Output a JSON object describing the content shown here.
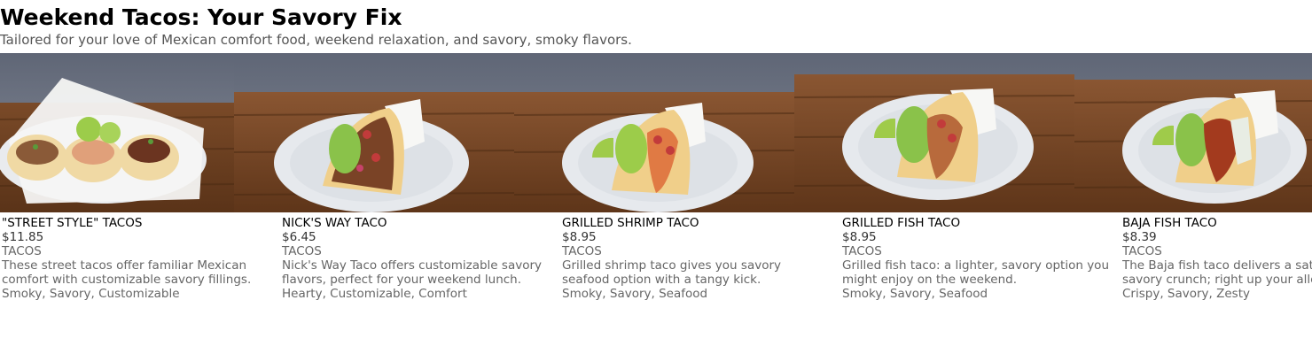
{
  "page": {
    "title": "Weekend Tacos: Your Savory Fix",
    "subtitle": "Tailored for your love of Mexican comfort food, weekend relaxation, and savory, smoky flavors."
  },
  "items": [
    {
      "name": "\"STREET STYLE\" TACOS",
      "price": "$11.85",
      "category": "TACOS",
      "description": "These street tacos offer familiar Mexican comfort with customizable savory fillings.",
      "tags": "Smoky, Savory, Customizable"
    },
    {
      "name": "NICK'S WAY TACO",
      "price": "$6.45",
      "category": "TACOS",
      "description": "Nick's Way Taco offers customizable savory flavors, perfect for your weekend lunch.",
      "tags": "Hearty, Customizable, Comfort"
    },
    {
      "name": "GRILLED SHRIMP TACO",
      "price": "$8.95",
      "category": "TACOS",
      "description": "Grilled shrimp taco gives you savory seafood option with a tangy kick.",
      "tags": "Smoky, Savory, Seafood"
    },
    {
      "name": "GRILLED FISH TACO",
      "price": "$8.95",
      "category": "TACOS",
      "description": "Grilled fish taco: a lighter, savory option you might enjoy on the weekend.",
      "tags": "Smoky, Savory, Seafood"
    },
    {
      "name": "BAJA FISH TACO",
      "price": "$8.39",
      "category": "TACOS",
      "description": "The Baja fish taco delivers a satisfying savory crunch; right up your alley.",
      "tags": "Crispy, Savory, Zesty"
    }
  ]
}
